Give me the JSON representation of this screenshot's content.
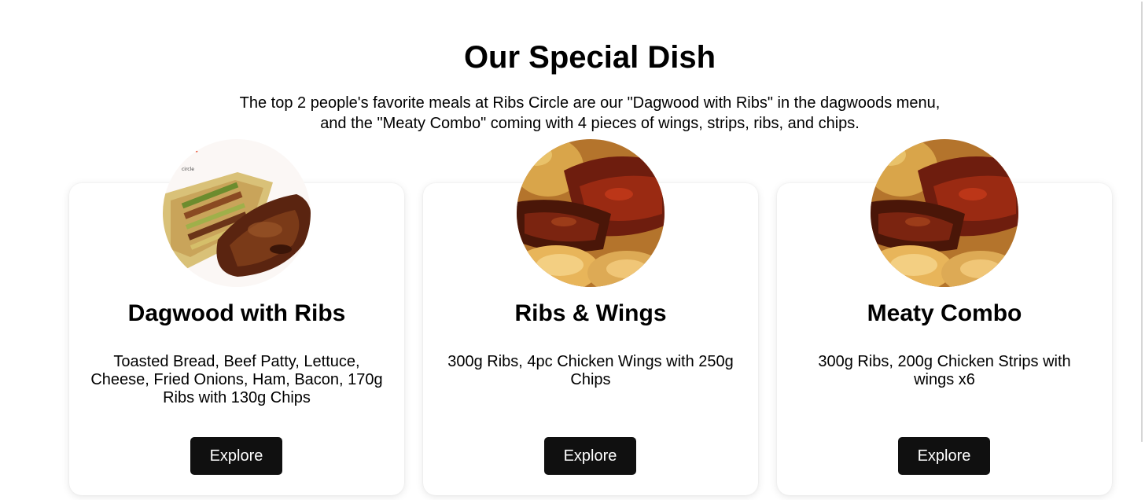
{
  "section": {
    "title": "Our Special Dish",
    "intro_line1": "The top 2 people's favorite meals at Ribs Circle are our \"Dagwood with Ribs\" in the dagwoods menu,",
    "intro_line2": "and the \"Meaty Combo\" coming with 4 pieces of wings, strips, ribs, and chips."
  },
  "dishes": [
    {
      "name": "Dagwood with Ribs",
      "description": "Toasted Bread, Beef Patty, Lettuce, Cheese, Fried Onions, Ham, Bacon, 170g Ribs with 130g Chips",
      "button_label": "Explore",
      "image": "dagwood-sandwich-ribs-photo",
      "logo_text": "circle"
    },
    {
      "name": "Ribs & Wings",
      "description": "300g Ribs, 4pc Chicken Wings with 250g Chips",
      "button_label": "Explore",
      "image": "ribs-wings-photo"
    },
    {
      "name": "Meaty Combo",
      "description": "300g Ribs, 200g Chicken Strips with wings x6",
      "button_label": "Explore",
      "image": "ribs-wings-photo"
    }
  ],
  "colors": {
    "button_bg": "#101010",
    "button_text": "#ffffff",
    "card_bg": "#ffffff",
    "rib_glaze": "#7a2a12"
  }
}
